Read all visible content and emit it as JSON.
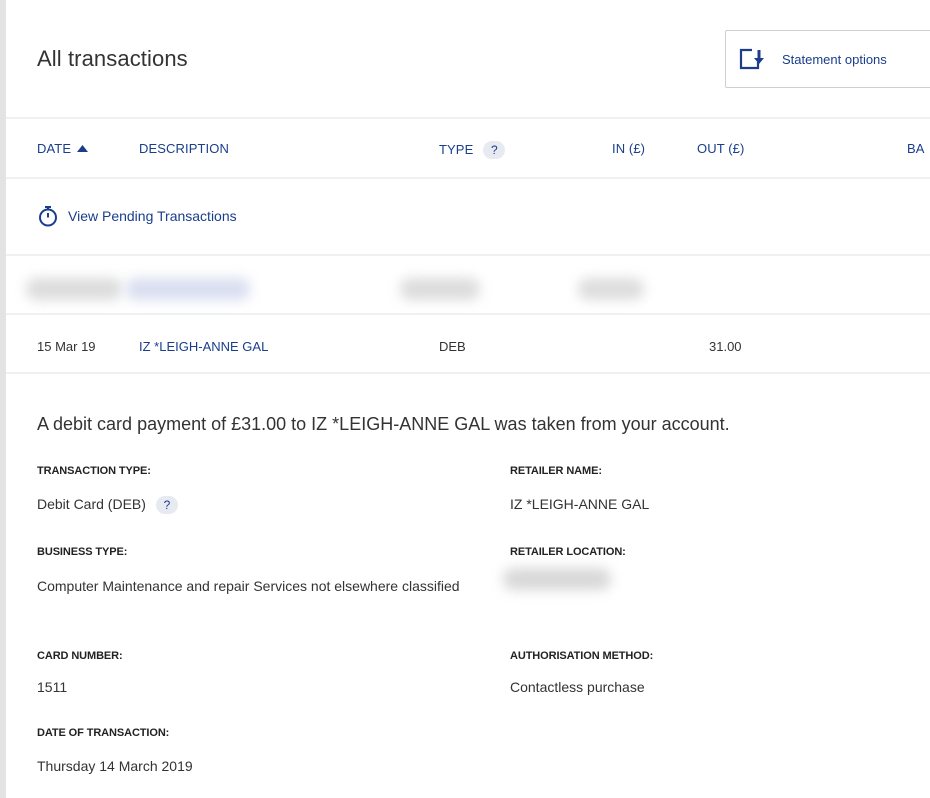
{
  "page": {
    "title": "All transactions"
  },
  "statement_button": {
    "label": "Statement options",
    "icon": "statement-download-icon"
  },
  "table": {
    "headers": {
      "date": "DATE",
      "description": "DESCRIPTION",
      "type": "TYPE",
      "type_help": "?",
      "in": "IN (£)",
      "out": "OUT (£)",
      "balance": "BA"
    },
    "pending_link": "View Pending Transactions",
    "rows": [
      {
        "date": "15 Mar 19",
        "description": "IZ *LEIGH-ANNE GAL",
        "type": "DEB",
        "in": "",
        "out": "31.00"
      }
    ]
  },
  "detail": {
    "heading": "A debit card payment of £31.00 to IZ *LEIGH-ANNE GAL was taken from your account.",
    "transaction_type_label": "TRANSACTION TYPE:",
    "transaction_type_value": "Debit Card (DEB)",
    "transaction_type_help": "?",
    "retailer_name_label": "RETAILER NAME:",
    "retailer_name_value": "IZ *LEIGH-ANNE GAL",
    "business_type_label": "BUSINESS TYPE:",
    "business_type_value": "Computer Maintenance and repair Services not elsewhere classified",
    "retailer_location_label": "RETAILER LOCATION:",
    "card_number_label": "CARD NUMBER:",
    "card_number_value": "1511",
    "authorisation_label": "AUTHORISATION METHOD:",
    "authorisation_value": "Contactless purchase",
    "date_label": "DATE OF TRANSACTION:",
    "date_value": "Thursday 14 March 2019"
  },
  "colors": {
    "link": "#1a3e8c",
    "text": "#333333",
    "divider": "#f0f0f0"
  }
}
